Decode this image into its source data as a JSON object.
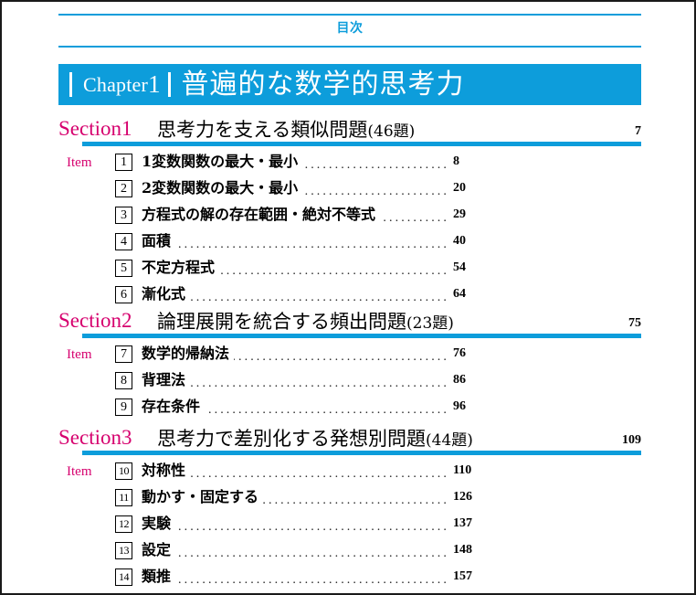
{
  "running_head": {
    "title": "目次"
  },
  "chapter": {
    "label": "Chapter",
    "number": "1",
    "title": "普遍的な数学的思考力"
  },
  "sections": [
    {
      "label": "Section1",
      "title": "思考力を支える類似問題",
      "count": "(46題)",
      "page": "7",
      "item_word": "Item",
      "items": [
        {
          "num": "1",
          "title": "1変数関数の最大・最小",
          "page": "8"
        },
        {
          "num": "2",
          "title": "2変数関数の最大・最小",
          "page": "20"
        },
        {
          "num": "3",
          "title": "方程式の解の存在範囲・絶対不等式",
          "page": "29"
        },
        {
          "num": "4",
          "title": "面積",
          "page": "40"
        },
        {
          "num": "5",
          "title": "不定方程式",
          "page": "54"
        },
        {
          "num": "6",
          "title": "漸化式",
          "page": "64"
        }
      ]
    },
    {
      "label": "Section2",
      "title": "論理展開を統合する頻出問題",
      "count": "(23題)",
      "page": "75",
      "item_word": "Item",
      "items": [
        {
          "num": "7",
          "title": "数学的帰納法",
          "page": "76"
        },
        {
          "num": "8",
          "title": "背理法",
          "page": "86"
        },
        {
          "num": "9",
          "title": "存在条件",
          "page": "96"
        }
      ]
    },
    {
      "label": "Section3",
      "title": "思考力で差別化する発想別問題",
      "count": "(44題)",
      "page": "109",
      "item_word": "Item",
      "items": [
        {
          "num": "10",
          "title": "対称性",
          "page": "110"
        },
        {
          "num": "11",
          "title": "動かす・固定する",
          "page": "126"
        },
        {
          "num": "12",
          "title": "実験",
          "page": "137"
        },
        {
          "num": "13",
          "title": "設定",
          "page": "148"
        },
        {
          "num": "14",
          "title": "類推",
          "page": "157"
        }
      ]
    }
  ],
  "colors": {
    "accent_blue": "#0d9ddb",
    "accent_magenta": "#d6006e",
    "text": "#000000"
  }
}
